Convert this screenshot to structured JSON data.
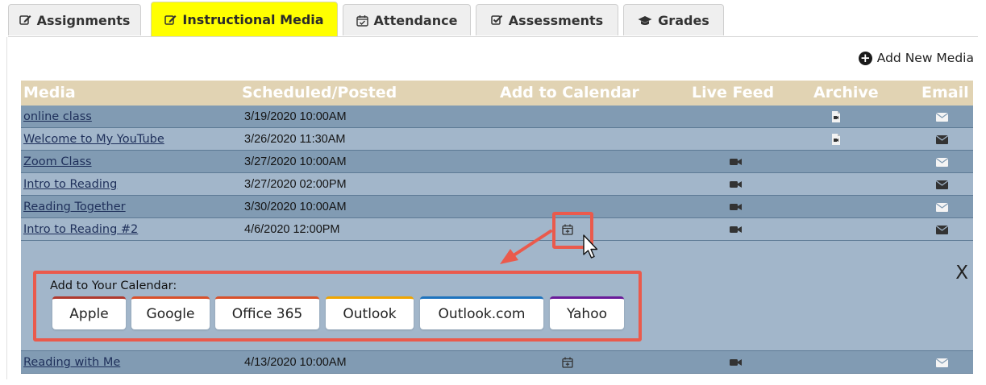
{
  "tabs": [
    {
      "label": "Assignments",
      "icon": "edit-icon",
      "active": false
    },
    {
      "label": "Instructional Media",
      "icon": "edit-icon",
      "active": true
    },
    {
      "label": "Attendance",
      "icon": "calendar-check-icon",
      "active": false
    },
    {
      "label": "Assessments",
      "icon": "check-square-icon",
      "active": false
    },
    {
      "label": "Grades",
      "icon": "graduation-cap-icon",
      "active": false
    }
  ],
  "add_new_media": {
    "label": "Add New Media",
    "icon": "plus-circle-icon"
  },
  "table": {
    "headers": [
      "Media",
      "Scheduled/Posted",
      "Add to Calendar",
      "Live Feed",
      "Archive",
      "Email"
    ],
    "rows": [
      {
        "media": "online class",
        "scheduled": "3/19/2020 10:00AM",
        "calendar": false,
        "live_feed": false,
        "archive": true,
        "email": true
      },
      {
        "media": "Welcome to My YouTube",
        "scheduled": "3/26/2020 11:30AM",
        "calendar": false,
        "live_feed": false,
        "archive": true,
        "email": true
      },
      {
        "media": "Zoom Class",
        "scheduled": "3/27/2020 10:00AM",
        "calendar": false,
        "live_feed": true,
        "archive": false,
        "email": true
      },
      {
        "media": "Intro to Reading",
        "scheduled": "3/27/2020 02:00PM",
        "calendar": false,
        "live_feed": true,
        "archive": false,
        "email": true
      },
      {
        "media": "Reading Together",
        "scheduled": "3/30/2020 10:00AM",
        "calendar": false,
        "live_feed": true,
        "archive": false,
        "email": true
      },
      {
        "media": "Intro to Reading #2",
        "scheduled": "4/6/2020 12:00PM",
        "calendar": true,
        "live_feed": true,
        "archive": false,
        "email": true
      },
      {
        "media": "Reading with Me",
        "scheduled": "4/13/2020 10:00AM",
        "calendar": true,
        "live_feed": true,
        "archive": false,
        "email": true
      }
    ]
  },
  "calendar_popup": {
    "label": "Add to Your Calendar:",
    "close": "X",
    "options": [
      {
        "label": "Apple",
        "color": "#b03a2e"
      },
      {
        "label": "Google",
        "color": "#d9502a"
      },
      {
        "label": "Office 365",
        "color": "#d9502a"
      },
      {
        "label": "Outlook",
        "color": "#f0a500"
      },
      {
        "label": "Outlook.com",
        "color": "#1e73be"
      },
      {
        "label": "Yahoo",
        "color": "#6a1b9a"
      }
    ]
  },
  "colors": {
    "active_tab": "#ffff00",
    "header_bg": "#e1d3b3",
    "row_dark": "#819bb3",
    "row_light": "#a2b6ca",
    "annotation": "#ea5a4c"
  }
}
